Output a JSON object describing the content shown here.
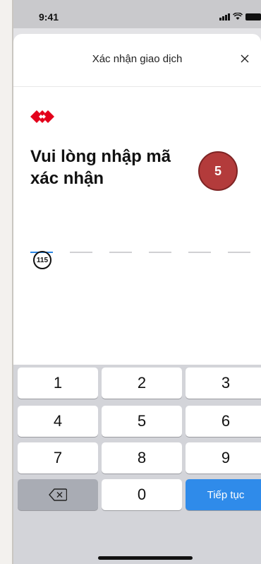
{
  "status_bar": {
    "time": "9:41"
  },
  "header": {
    "title": "Xác nhận giao dịch",
    "close_label": "×"
  },
  "main": {
    "heading": "Vui lòng nhập mã xác nhận",
    "step_badge": "5",
    "otp_length": 6,
    "otp_filled": 0,
    "timer_seconds": "115"
  },
  "keypad": {
    "keys": [
      "1",
      "2",
      "3",
      "4",
      "5",
      "6",
      "7",
      "8",
      "9",
      "0"
    ],
    "submit_label": "Tiếp tục",
    "backspace_icon": "backspace-icon"
  },
  "colors": {
    "accent": "#2f8bea",
    "brand_red": "#e3001b",
    "badge": "#b33b3b"
  }
}
